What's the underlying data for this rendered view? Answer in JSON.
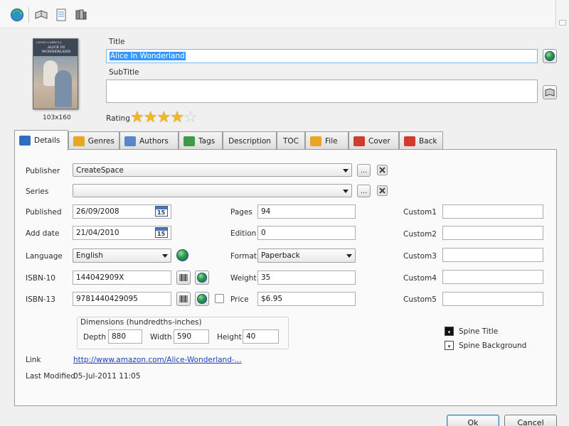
{
  "toolbar": {
    "icons": [
      "globe-refresh-icon",
      "book-open-icon",
      "page-icon",
      "books-stack-icon"
    ]
  },
  "cover": {
    "size_label": "103x160",
    "author_text": "LEWIS CARROLL",
    "title_text": "ALICE IN WONDERLAND"
  },
  "header": {
    "title_label": "Title",
    "title_value": "Alice In Wonderland",
    "subtitle_label": "SubTitle",
    "subtitle_value": "",
    "rating_label": "Rating",
    "rating_value": 4,
    "rating_max": 5
  },
  "tabs": [
    {
      "label": "Details",
      "icon": "book-blue-icon",
      "active": true
    },
    {
      "label": "Genres",
      "icon": "box-icon",
      "active": false
    },
    {
      "label": "Authors",
      "icon": "people-icon",
      "active": false
    },
    {
      "label": "Tags",
      "icon": "tags-icon",
      "active": false
    },
    {
      "label": "Description",
      "icon": "",
      "active": false
    },
    {
      "label": "TOC",
      "icon": "",
      "active": false
    },
    {
      "label": "File",
      "icon": "box-icon",
      "active": false
    },
    {
      "label": "Cover",
      "icon": "book-red-icon",
      "active": false
    },
    {
      "label": "Back",
      "icon": "book-red-icon",
      "active": false
    }
  ],
  "details": {
    "publisher_label": "Publisher",
    "publisher_value": "CreateSpace",
    "series_label": "Series",
    "series_value": "",
    "browse_label": "...",
    "published_label": "Published",
    "published_value": "26/09/2008",
    "adddate_label": "Add date",
    "adddate_value": "21/04/2010",
    "calendar_day": "15",
    "language_label": "Language",
    "language_value": "English",
    "isbn10_label": "ISBN-10",
    "isbn10_value": "144042909X",
    "isbn13_label": "ISBN-13",
    "isbn13_value": "9781440429095",
    "pages_label": "Pages",
    "pages_value": "94",
    "edition_label": "Edition",
    "edition_value": "0",
    "format_label": "Format",
    "format_value": "Paperback",
    "weight_label": "Weight",
    "weight_value": "35",
    "price_label": "Price",
    "price_value": "$6.95",
    "custom1_label": "Custom1",
    "custom2_label": "Custom2",
    "custom3_label": "Custom3",
    "custom4_label": "Custom4",
    "custom5_label": "Custom5",
    "dimensions_label": "Dimensions (hundredths-inches)",
    "depth_label": "Depth",
    "depth_value": "880",
    "width_label": "Width",
    "width_value": "590",
    "height_label": "Height",
    "height_value": "40",
    "spine_title_label": "Spine Title",
    "spine_background_label": "Spine Background",
    "link_label": "Link",
    "link_value": "http://www.amazon.com/Alice-Wonderland-...",
    "last_modified_label": "Last Modified",
    "last_modified_value": "05-Jul-2011 11:05"
  },
  "footer": {
    "ok_label": "Ok",
    "cancel_label": "Cancel"
  },
  "colors": {
    "accent": "#3c7fb1",
    "star": "#f2b91e",
    "link": "#1a3fb8"
  }
}
